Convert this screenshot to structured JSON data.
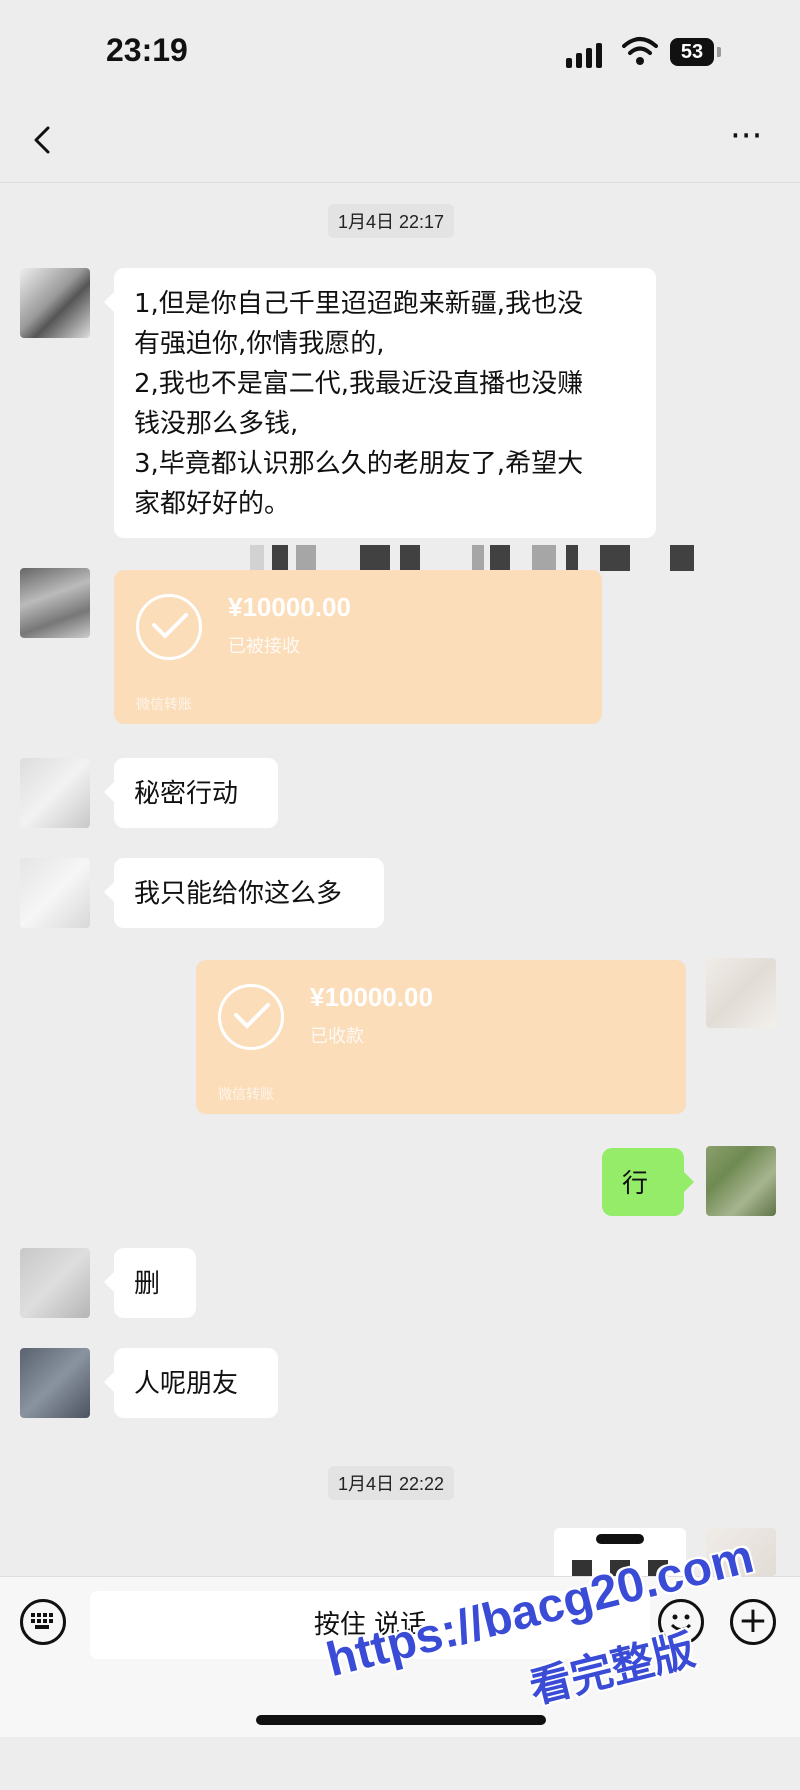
{
  "status_bar": {
    "time": "23:19",
    "battery": "53"
  },
  "header": {
    "more": "···"
  },
  "timestamps": [
    "1月4日 22:17",
    "1月4日 22:22"
  ],
  "messages": {
    "m1_lines": [
      "1,但是你自己千里迢迢跑来新疆,我也没",
      "有强迫你,你情我愿的,",
      "2,我也不是富二代,我最近没直播也没赚",
      "钱没那么多钱,",
      "3,毕竟都认识那么久的老朋友了,希望大",
      "家都好好的。"
    ],
    "transfer_1": {
      "amount": "¥10000.00",
      "status": "已被接收",
      "footer": "微信转账"
    },
    "m2": "秘密行动",
    "m3": "我只能给你这么多",
    "transfer_2": {
      "amount": "¥10000.00",
      "status": "已收款",
      "footer": "微信转账"
    },
    "m4": "行",
    "m5": "删",
    "m6": "人呢朋友"
  },
  "input_bar": {
    "hold_to_talk": "按住 说话"
  },
  "watermark": {
    "line1": "https://bacg20.com",
    "line2": "看完整版"
  },
  "colors": {
    "background": "#ededed",
    "transfer": "#fbddb9",
    "self_bubble": "#95ec69",
    "watermark": "#3a4bd6"
  }
}
